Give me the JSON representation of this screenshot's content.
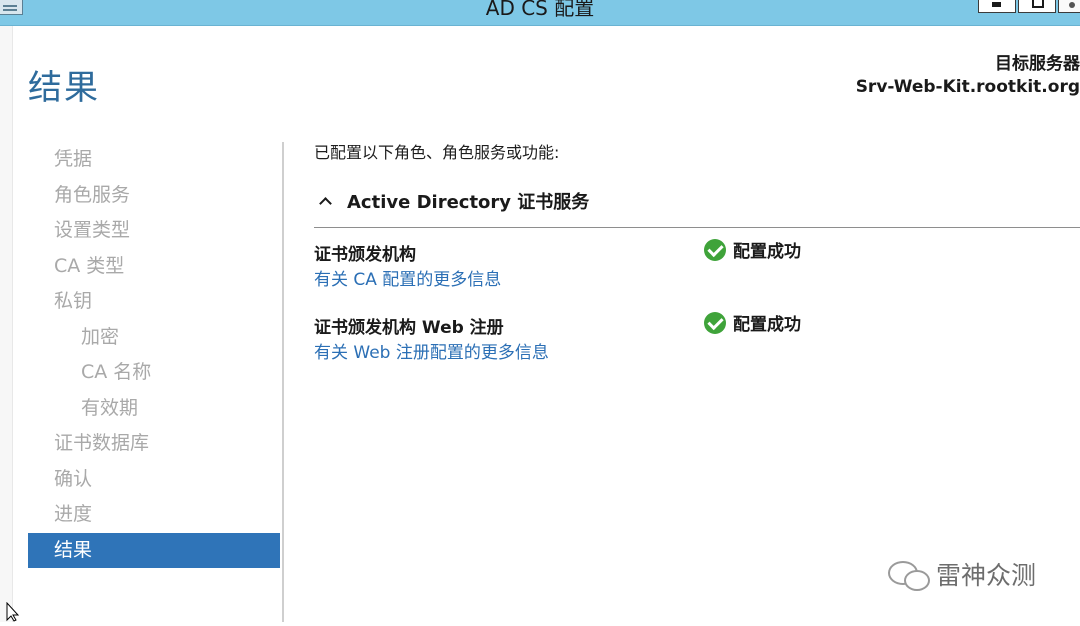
{
  "window": {
    "title": "AD CS 配置"
  },
  "header": {
    "page_title": "结果",
    "target_label": "目标服务器",
    "target_server": "Srv-Web-Kit.rootkit.org"
  },
  "nav": {
    "items": [
      {
        "label": "凭据",
        "level": 1,
        "active": false
      },
      {
        "label": "角色服务",
        "level": 1,
        "active": false
      },
      {
        "label": "设置类型",
        "level": 1,
        "active": false
      },
      {
        "label": "CA 类型",
        "level": 1,
        "active": false
      },
      {
        "label": "私钥",
        "level": 1,
        "active": false
      },
      {
        "label": "加密",
        "level": 2,
        "active": false
      },
      {
        "label": "CA 名称",
        "level": 2,
        "active": false
      },
      {
        "label": "有效期",
        "level": 2,
        "active": false
      },
      {
        "label": "证书数据库",
        "level": 1,
        "active": false
      },
      {
        "label": "确认",
        "level": 1,
        "active": false
      },
      {
        "label": "进度",
        "level": 1,
        "active": false
      },
      {
        "label": "结果",
        "level": 1,
        "active": true
      }
    ]
  },
  "main": {
    "intro": "已配置以下角色、角色服务或功能:",
    "section_title": "Active Directory 证书服务",
    "results": [
      {
        "feature": "证书颁发机构",
        "link": "有关 CA 配置的更多信息",
        "status": "配置成功"
      },
      {
        "feature": "证书颁发机构 Web 注册",
        "link": "有关 Web 注册配置的更多信息",
        "status": "配置成功"
      }
    ]
  },
  "watermark": {
    "text": "雷神众测"
  },
  "colors": {
    "titlebar": "#7ec8e6",
    "accent": "#2f74b8",
    "link": "#2b6fb5",
    "success": "#3fa33a",
    "nav_inactive": "#a9a9a9"
  }
}
